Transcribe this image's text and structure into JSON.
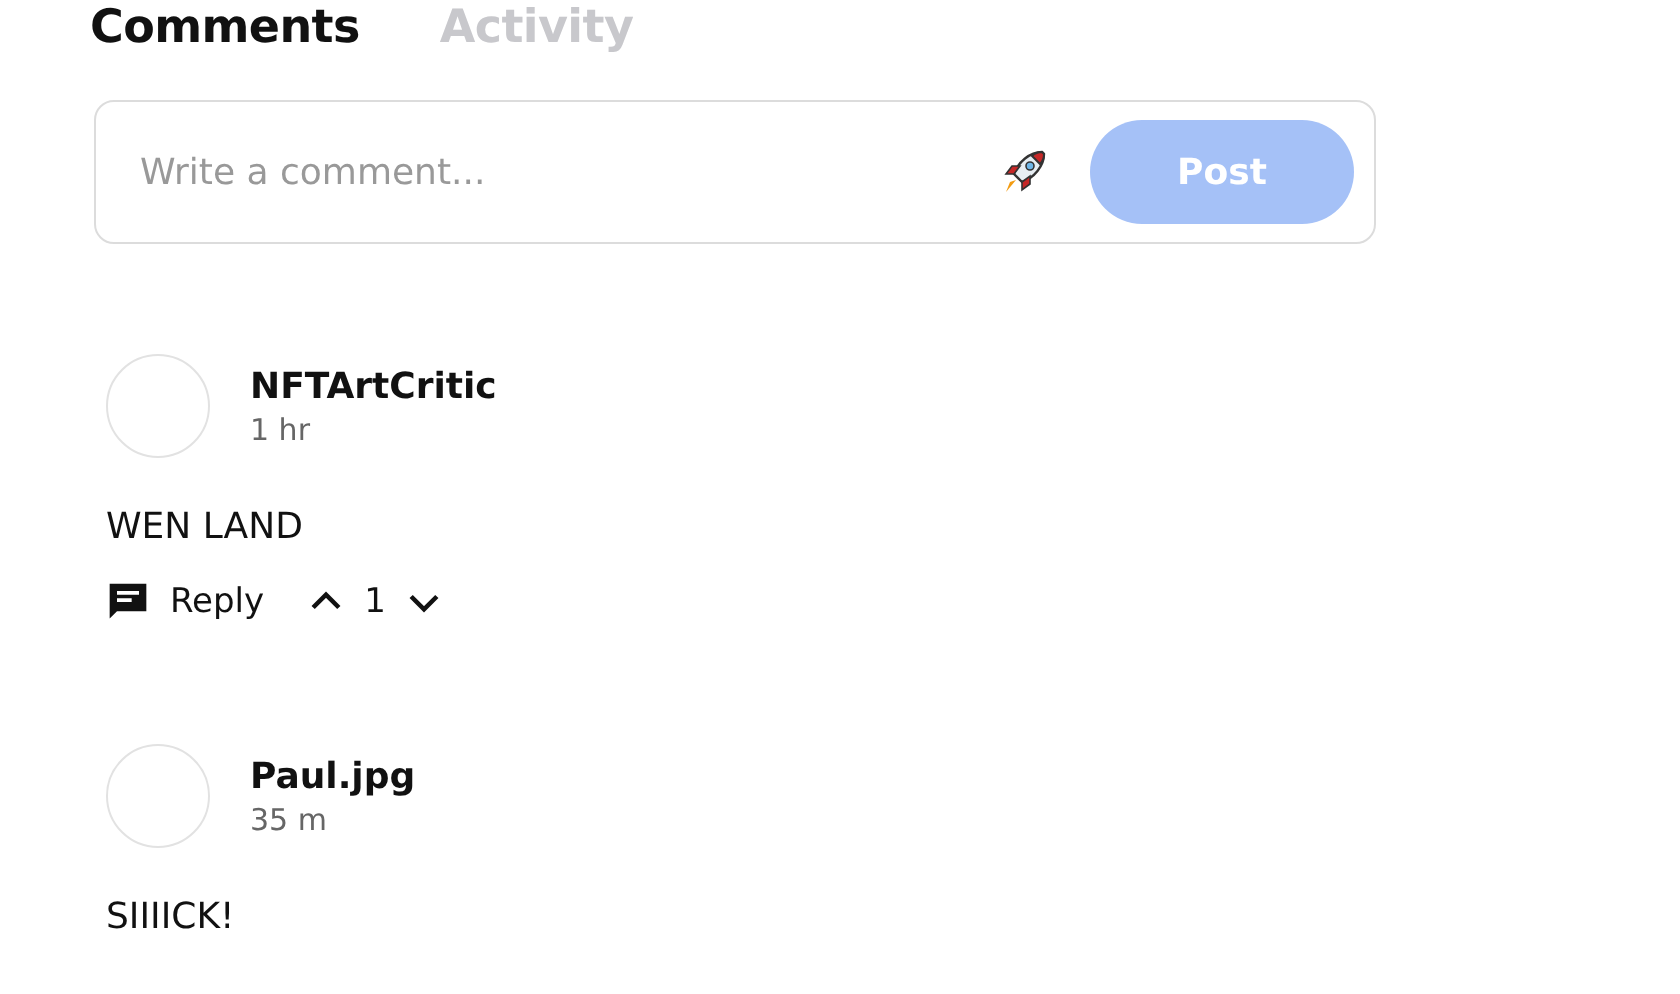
{
  "tabs": [
    {
      "label": "Comments",
      "selected": true
    },
    {
      "label": "Activity",
      "selected": false
    }
  ],
  "composer": {
    "placeholder": "Write a comment...",
    "post_button": {
      "label": "Post",
      "disabled": true
    }
  },
  "comments": [
    {
      "author": "NFTArtCritic",
      "time": "1 hr",
      "text": "WEN LAND",
      "actions": {
        "reply": "Reply",
        "votes": "1"
      }
    },
    {
      "author": "Paul.jpg",
      "time": "35 m",
      "text": "SIIIICK!"
    }
  ]
}
